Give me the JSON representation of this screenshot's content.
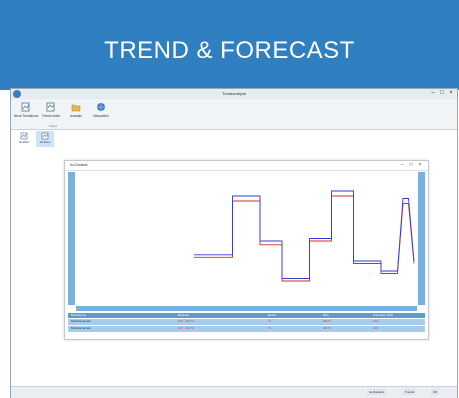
{
  "banner": {
    "title": "TREND & FORECAST"
  },
  "window": {
    "title": "Trendanalyse",
    "controls": [
      "–",
      "□",
      "×"
    ]
  },
  "ribbon": {
    "buttons": [
      {
        "label": "Neue Trendkurve",
        "icon": "new-chart-icon"
      },
      {
        "label": "Trends laden",
        "icon": "load-trends-icon"
      },
      {
        "label": "Auswahl",
        "icon": "folder-icon"
      },
      {
        "label": "Neuplotten",
        "icon": "globe-icon"
      }
    ],
    "group_label": "Trend"
  },
  "subtoolbar": {
    "buttons": [
      {
        "label": "Ist-Wert",
        "icon": "chart-doc-icon",
        "active": false
      },
      {
        "label": "Ist-Zust.",
        "icon": "chart-doc-icon",
        "active": true
      }
    ]
  },
  "child_window": {
    "title": "Ist-Zustand",
    "controls": [
      "–",
      "□",
      "×"
    ]
  },
  "chart_data": {
    "type": "line",
    "x": [
      0,
      1,
      2,
      3,
      4,
      5,
      6,
      7,
      8,
      9,
      10,
      11,
      12,
      13,
      14,
      15,
      16,
      17,
      18,
      19,
      20,
      21,
      22,
      23,
      24,
      25,
      26,
      27,
      28,
      29,
      30,
      31,
      32,
      33,
      34,
      35,
      36,
      37,
      38,
      39,
      40
    ],
    "series": [
      {
        "color": "#d22b2b",
        "values": [
          35,
          35,
          35,
          35,
          35,
          35,
          35,
          80,
          80,
          80,
          80,
          80,
          45,
          45,
          45,
          45,
          16,
          16,
          16,
          16,
          16,
          48,
          48,
          48,
          48,
          84,
          84,
          84,
          84,
          30,
          30,
          30,
          30,
          30,
          22,
          22,
          22,
          22,
          78,
          78,
          30
        ]
      },
      {
        "color": "#2b3fd2",
        "values": [
          37,
          37,
          37,
          37,
          37,
          37,
          37,
          84,
          84,
          84,
          84,
          84,
          48,
          48,
          48,
          48,
          18,
          18,
          18,
          18,
          18,
          50,
          50,
          50,
          50,
          88,
          88,
          88,
          88,
          32,
          32,
          32,
          32,
          32,
          24,
          24,
          24,
          24,
          82,
          82,
          32
        ]
      }
    ],
    "ylim": [
      0,
      100
    ]
  },
  "table": {
    "headers": [
      "Bezeichnung",
      "Messwert",
      "Einheit",
      "Wert",
      "Grenzwert / Stufe"
    ],
    "rows": [
      [
        "Bodentemperatur",
        "12,5 - 10,8 °C",
        "°C",
        "460 °C",
        "12,5"
      ],
      [
        "Bodentemperatur",
        "12,5 - 10,8 °C",
        "°C",
        "460 °C",
        "12,5"
      ]
    ]
  },
  "statusbar": {
    "items": [
      "Ist-Zustand",
      "Trends",
      "OK"
    ]
  },
  "colors": {
    "brand": "#2f7fc1",
    "axis": "#7ab0de"
  }
}
